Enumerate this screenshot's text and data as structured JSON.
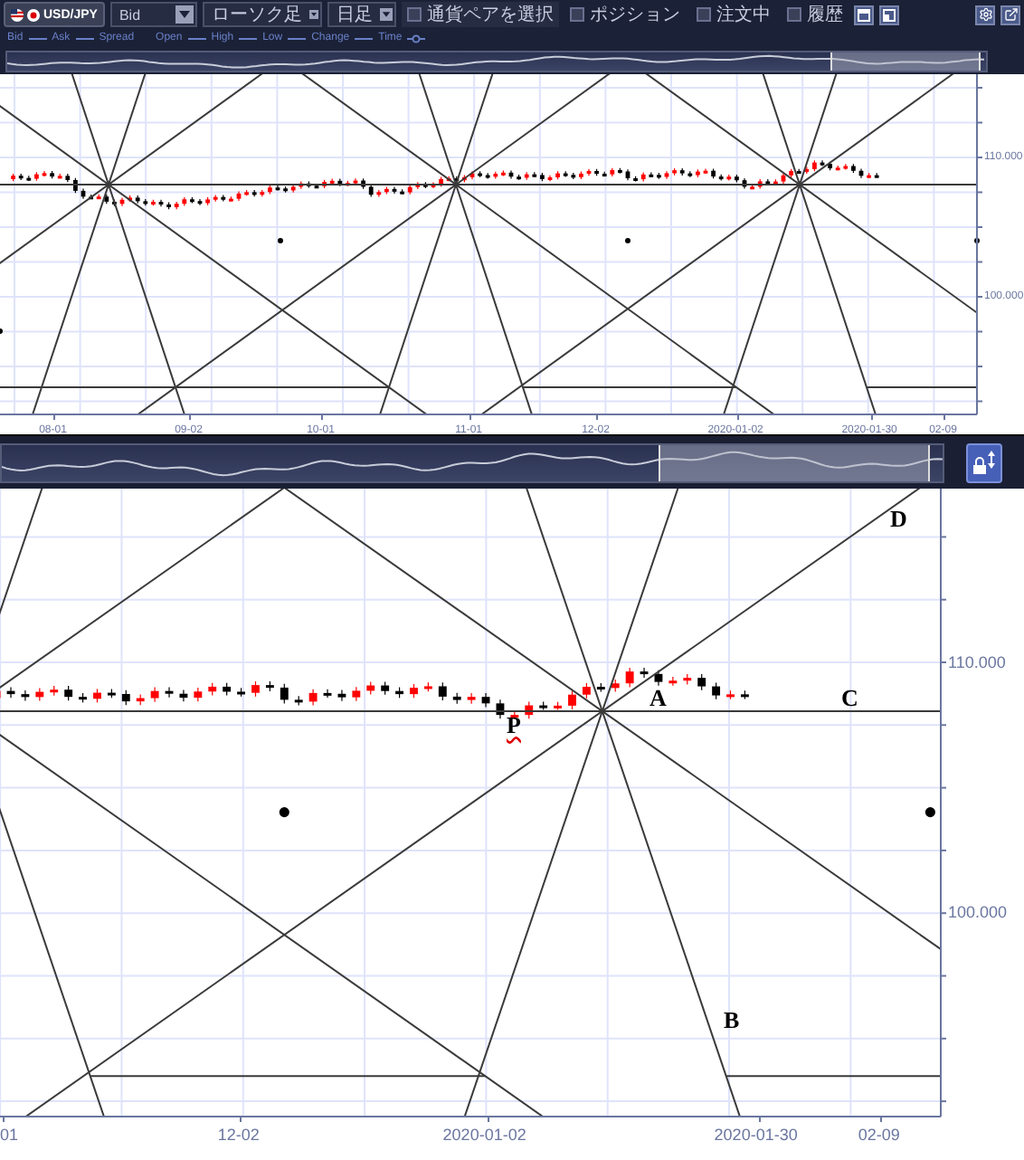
{
  "toolbar": {
    "pair": "USD/JPY",
    "price_type": "Bid",
    "chart_type": "ローソク足",
    "period": "日足",
    "pair_select": {
      "label": "通貨ペアを選択",
      "checked": false
    },
    "toggles": [
      {
        "label": "ポジション",
        "checked": false
      },
      {
        "label": "注文中",
        "checked": false
      },
      {
        "label": "履歴",
        "checked": false
      }
    ]
  },
  "legend": [
    {
      "label": "Bid",
      "kind": "line"
    },
    {
      "label": "Ask",
      "kind": "line"
    },
    {
      "label": "Spread",
      "kind": "plain"
    },
    {
      "label": "Open",
      "kind": "line"
    },
    {
      "label": "High",
      "kind": "line"
    },
    {
      "label": "Low",
      "kind": "line"
    },
    {
      "label": "Change",
      "kind": "line"
    },
    {
      "label": "Time",
      "kind": "circle"
    }
  ],
  "top_chart": {
    "y_labels": [
      "110.000",
      "100.000"
    ],
    "x_labels": [
      "08-01",
      "09-02",
      "10-01",
      "11-01",
      "12-02",
      "2020-01-02",
      "2020-01-30",
      "02-09"
    ]
  },
  "bottom_chart": {
    "y_labels": [
      "110.000",
      "100.000"
    ],
    "x_labels": [
      "01",
      "12-02",
      "2020-01-02",
      "2020-01-30",
      "02-09"
    ],
    "points": [
      {
        "label": "D",
        "misspelled": false
      },
      {
        "label": "A",
        "misspelled": false
      },
      {
        "label": "C",
        "misspelled": false
      },
      {
        "label": "P",
        "misspelled": true
      },
      {
        "label": "B",
        "misspelled": false
      }
    ]
  }
}
